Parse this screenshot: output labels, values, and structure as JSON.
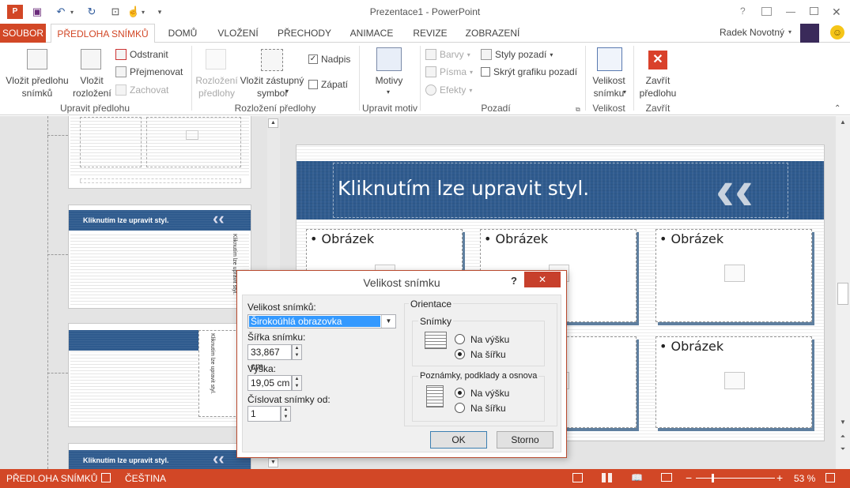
{
  "window": {
    "title": "Prezentace1 - PowerPoint",
    "user": "Radek Novotný",
    "help": "?",
    "minimize": "—",
    "close": "✕"
  },
  "tabs": [
    "SOUBOR",
    "PŘEDLOHA SNÍMKŮ",
    "DOMŮ",
    "VLOŽENÍ",
    "PŘECHODY",
    "ANIMACE",
    "REVIZE",
    "ZOBRAZENÍ"
  ],
  "ribbon": {
    "insert_master": "Vložit předlohu snímků",
    "insert_layout": "Vložit rozložení",
    "delete": "Odstranit",
    "rename": "Přejmenovat",
    "preserve": "Zachovat",
    "group_edit_master": "Upravit předlohu",
    "master_layout": "Rozložení předlohy",
    "insert_placeholder": "Vložit zástupný symbol",
    "title_cb": "Nadpis",
    "footer_cb": "Zápatí",
    "group_master_layout": "Rozložení předlohy",
    "themes": "Motivy",
    "group_edit_theme": "Upravit motiv",
    "colors": "Barvy",
    "fonts": "Písma",
    "effects": "Efekty",
    "bg_styles": "Styly pozadí",
    "hide_bg": "Skrýt grafiku pozadí",
    "group_bg": "Pozadí",
    "slide_size": "Velikost snímku",
    "group_size": "Velikost",
    "close_master": "Zavřít předlohu",
    "group_close": "Zavřít"
  },
  "thumbs": {
    "title": "Kliknutím lze upravit styl.",
    "vertical": "Kliknutím lze upravit styl."
  },
  "slide": {
    "title": "Kliknutím lze upravit styl.",
    "placeholder": "• Obrázek"
  },
  "dialog": {
    "title": "Velikost snímku",
    "size_label": "Velikost snímků:",
    "size_value": "Širokoúhlá obrazovka",
    "width_label": "Šířka snímku:",
    "width_value": "33,867 cm",
    "height_label": "Výška:",
    "height_value": "19,05 cm",
    "number_label": "Číslovat snímky od:",
    "number_value": "1",
    "orientation": "Orientace",
    "slides": "Snímky",
    "portrait": "Na výšku",
    "landscape": "Na šířku",
    "notes": "Poznámky, podklady a osnova",
    "notes_portrait": "Na výšku",
    "notes_landscape": "Na šířku",
    "ok": "OK",
    "cancel": "Storno"
  },
  "status": {
    "view": "PŘEDLOHA SNÍMKŮ",
    "language": "ČEŠTINA",
    "zoom": "53 %"
  },
  "colors": {
    "accent": "#d24726",
    "band": "#2f5b8e"
  }
}
